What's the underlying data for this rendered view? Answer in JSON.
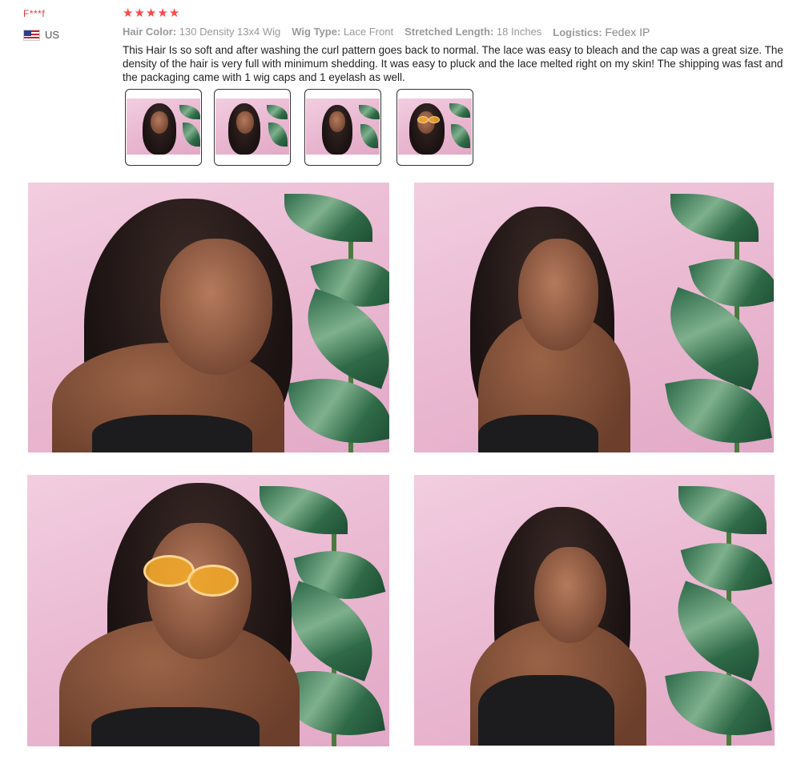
{
  "reviewer": {
    "name": "F***f",
    "country": "US",
    "flag_icon": "us-flag-icon"
  },
  "rating": {
    "stars": 5,
    "max": 5,
    "color": "#ff4747"
  },
  "attributes": [
    {
      "key": "Hair Color:",
      "value": "130 Density 13x4 Wig"
    },
    {
      "key": "Wig Type:",
      "value": "Lace Front"
    },
    {
      "key": "Stretched Length:",
      "value": "18 Inches"
    },
    {
      "key": "Logistics:",
      "value": "Fedex IP"
    }
  ],
  "review_text": "This Hair Is so soft and after washing the curl pattern goes back to normal. The lace was easy to bleach and the cap was a great size. The density of the hair is very full with minimum shedding. It was easy to pluck and the lace melted right on my skin! The shipping was fast and the packaging came with 1 wig caps and 1 eyelash as well.",
  "thumbnails": [
    {
      "name": "thumbnail-1"
    },
    {
      "name": "thumbnail-2"
    },
    {
      "name": "thumbnail-3"
    },
    {
      "name": "thumbnail-4"
    }
  ],
  "photos": [
    {
      "name": "review-photo-1"
    },
    {
      "name": "review-photo-2"
    },
    {
      "name": "review-photo-3"
    },
    {
      "name": "review-photo-4"
    }
  ]
}
